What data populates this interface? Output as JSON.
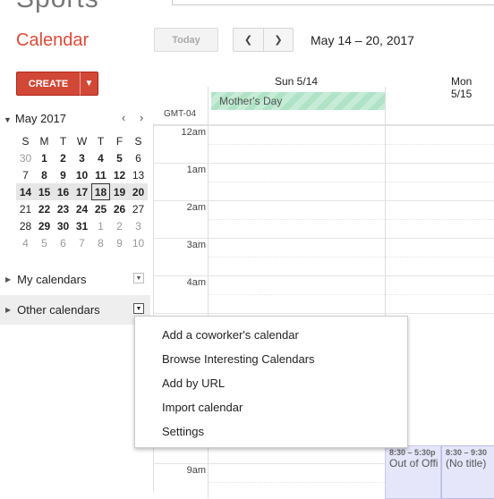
{
  "header": {
    "logo_partial": "Sports",
    "app_title": "Calendar",
    "today_label": "Today",
    "prev_label": "❮",
    "next_label": "❯",
    "date_range": "May 14 – 20, 2017"
  },
  "sidebar": {
    "create_label": "CREATE",
    "create_dropdown": "▼",
    "mini_calendar": {
      "title": "May 2017",
      "prev": "‹",
      "next": "›",
      "weekday_headers": [
        "S",
        "M",
        "T",
        "W",
        "T",
        "F",
        "S"
      ],
      "weeks": [
        [
          "30",
          "1",
          "2",
          "3",
          "4",
          "5",
          "6"
        ],
        [
          "7",
          "8",
          "9",
          "10",
          "11",
          "12",
          "13"
        ],
        [
          "14",
          "15",
          "16",
          "17",
          "18",
          "19",
          "20"
        ],
        [
          "21",
          "22",
          "23",
          "24",
          "25",
          "26",
          "27"
        ],
        [
          "28",
          "29",
          "30",
          "31",
          "1",
          "2",
          "3"
        ],
        [
          "4",
          "5",
          "6",
          "7",
          "8",
          "9",
          "10"
        ]
      ],
      "today": "18"
    },
    "my_calendars": "My calendars",
    "other_calendars": "Other calendars"
  },
  "grid": {
    "days": [
      "Sun 5/14",
      "Mon 5/15"
    ],
    "timezone": "GMT-04",
    "hours": [
      "12am",
      "1am",
      "2am",
      "3am",
      "4am",
      "9am"
    ],
    "all_day_event": "Mother's Day",
    "events": [
      {
        "time": "8:30 – 5:30p",
        "title": "Out of Offi"
      },
      {
        "time": "8:30 – 9:30",
        "title": "(No title)"
      }
    ]
  },
  "context_menu": {
    "items": [
      "Add a coworker's calendar",
      "Browse Interesting Calendars",
      "Add by URL",
      "Import calendar",
      "Settings"
    ]
  },
  "colors": {
    "brand": "#dd4b39",
    "create_button": "#d14836",
    "holiday_event": "#c6ecd7",
    "event_bg": "#e6e6fa"
  }
}
